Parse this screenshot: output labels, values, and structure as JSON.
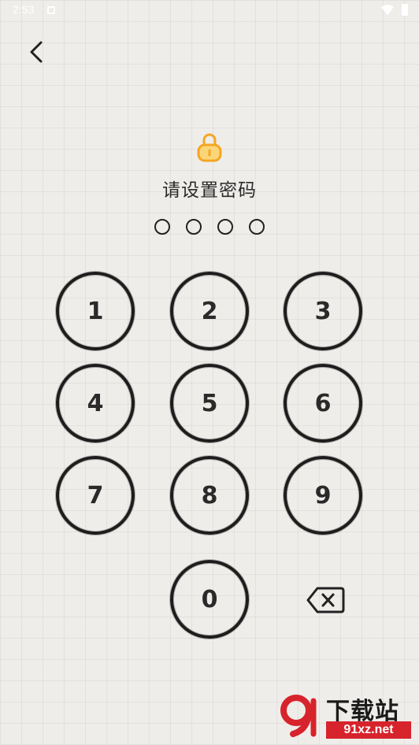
{
  "status_bar": {
    "time": "2:53"
  },
  "header": {
    "title": "请设置密码"
  },
  "passcode": {
    "length": 4,
    "filled": 0
  },
  "keypad": {
    "keys": [
      "1",
      "2",
      "3",
      "4",
      "5",
      "6",
      "7",
      "8",
      "9",
      "0"
    ],
    "backspace_icon": "backspace-icon"
  },
  "icons": {
    "back": "chevron-left-icon",
    "lock": "lock-icon"
  },
  "colors": {
    "lock": "#f5a623",
    "ink": "#1d1d1d",
    "watermark_red": "#d7232b"
  },
  "watermark": {
    "title": "下载站",
    "url": "91xz.net"
  }
}
